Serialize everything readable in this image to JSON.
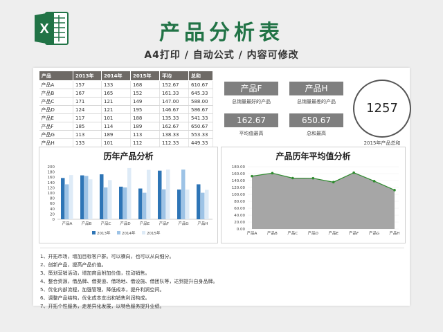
{
  "header": {
    "title": "产品分析表",
    "subtitle": "A4打印 / 自动公式 / 内容可修改",
    "logo_letter": "X",
    "brand_color": "#217346"
  },
  "table": {
    "headers": [
      "产品",
      "2013年",
      "2014年",
      "2015年",
      "平均",
      "总和"
    ],
    "rows": [
      [
        "产品A",
        "157",
        "133",
        "168",
        "152.67",
        "610.67"
      ],
      [
        "产品B",
        "167",
        "165",
        "152",
        "161.33",
        "645.33"
      ],
      [
        "产品C",
        "171",
        "121",
        "149",
        "147.00",
        "588.00"
      ],
      [
        "产品D",
        "124",
        "121",
        "195",
        "146.67",
        "586.67"
      ],
      [
        "产品E",
        "117",
        "101",
        "188",
        "135.33",
        "541.33"
      ],
      [
        "产品F",
        "185",
        "114",
        "189",
        "162.67",
        "650.67"
      ],
      [
        "产品G",
        "113",
        "189",
        "113",
        "138.33",
        "553.33"
      ],
      [
        "产品H",
        "133",
        "101",
        "112",
        "112.33",
        "449.33"
      ]
    ]
  },
  "kpis": {
    "best": {
      "value": "产品F",
      "label": "总销量最好的产品"
    },
    "worst": {
      "value": "产品H",
      "label": "总销量最差的产品"
    },
    "avg_high": {
      "value": "162.67",
      "label": "平均值最高"
    },
    "sum_high": {
      "value": "650.67",
      "label": "总和最高"
    },
    "total_2015": {
      "value": "1257",
      "label": "2015年产品总和"
    }
  },
  "chart_data": [
    {
      "type": "bar",
      "title": "历年产品分析",
      "categories": [
        "产品A",
        "产品B",
        "产品C",
        "产品D",
        "产品E",
        "产品F",
        "产品G",
        "产品H"
      ],
      "series": [
        {
          "name": "2013年",
          "color": "#2e75b6",
          "values": [
            157,
            167,
            171,
            124,
            117,
            185,
            113,
            133
          ]
        },
        {
          "name": "2014年",
          "color": "#9dc3e6",
          "values": [
            133,
            165,
            121,
            121,
            101,
            114,
            189,
            101
          ]
        },
        {
          "name": "2015年",
          "color": "#deebf7",
          "values": [
            168,
            152,
            149,
            195,
            188,
            189,
            113,
            112
          ]
        }
      ],
      "yticks": [
        "0",
        "20",
        "40",
        "60",
        "80",
        "100",
        "120",
        "140",
        "160",
        "180",
        "200"
      ],
      "ylim": [
        0,
        200
      ],
      "legend": "bottom"
    },
    {
      "type": "area",
      "title": "产品历年平均值分析",
      "categories": [
        "产品A",
        "产品B",
        "产品C",
        "产品D",
        "产品E",
        "产品F",
        "产品G",
        "产品H"
      ],
      "values": [
        152.67,
        161.33,
        147.0,
        146.67,
        135.33,
        162.67,
        138.33,
        112.33
      ],
      "yticks": [
        "0.00",
        "20.00",
        "40.00",
        "60.00",
        "80.00",
        "100.00",
        "120.00",
        "140.00",
        "160.00",
        "180.00"
      ],
      "ylim": [
        0,
        180
      ],
      "fill_color": "#a6a6a6",
      "line_color": "#2e8b2e"
    }
  ],
  "notes": [
    "1、开拓市场，增加目标客户群。可以横向，也可以从向细分。",
    "2、创新产品，提高产品价值。",
    "3、策划营销活动，增加商品附加价值，拉动销售。",
    "4、整合资源，借品牌、借渠道、借场地、借设施、借团队等，达到提升自身品牌。",
    "5、优化内部流程，加强管理，降低成本，提升利润空间。",
    "6、调整产品结构，优化成本支出和销售利润构成。",
    "7、开拓个性服务，走差异化发展，以特色服务提升业绩。"
  ]
}
